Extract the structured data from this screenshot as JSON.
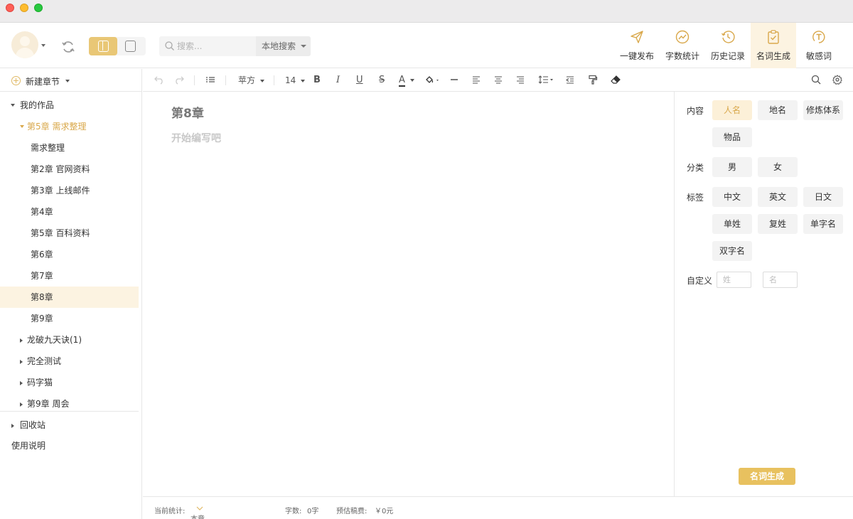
{
  "toolbar": {
    "search_placeholder": "搜索...",
    "search_scope": "本地搜索",
    "tools": [
      {
        "label": "一键发布",
        "icon": "paper-plane-icon"
      },
      {
        "label": "字数统计",
        "icon": "chart-icon"
      },
      {
        "label": "历史记录",
        "icon": "history-icon"
      },
      {
        "label": "名词生成",
        "icon": "clipboard-check-icon",
        "active": true
      },
      {
        "label": "敏感词",
        "icon": "text-circle-icon"
      }
    ]
  },
  "sidebar": {
    "new_chapter": "新建章节",
    "root": "我的作品",
    "expanded_volume": "第5章 需求整理",
    "chapters": [
      "需求整理",
      "第2章 官网资料",
      "第3章 上线邮件",
      "第4章",
      "第5章 百科资料",
      "第6章",
      "第7章",
      "第8章",
      "第9章"
    ],
    "selected_chapter": "第8章",
    "volumes": [
      "龙破九天诀(1)",
      "完全测试",
      "码字猫",
      "第9章 周会"
    ],
    "recycle_bin": "回收站",
    "manual": "使用说明"
  },
  "editor_toolbar": {
    "font": "苹方",
    "font_size": "14",
    "bold": "B",
    "italic": "I",
    "underline": "U",
    "strike": "S",
    "font_color": "A"
  },
  "editor": {
    "chapter_title": "第8章",
    "body_placeholder": "开始编写吧"
  },
  "panel": {
    "content_label": "内容",
    "content_options": [
      "人名",
      "地名",
      "修炼体系",
      "物品"
    ],
    "content_selected": "人名",
    "category_label": "分类",
    "category_options": [
      "男",
      "女"
    ],
    "tag_label": "标签",
    "tag_options": [
      "中文",
      "英文",
      "日文",
      "单姓",
      "复姓",
      "单字名",
      "双字名"
    ],
    "custom_label": "自定义",
    "surname_placeholder": "姓",
    "given_placeholder": "名",
    "generate_button": "名词生成"
  },
  "statusbar": {
    "stat_label": "当前统计:",
    "stat_scope": "本章",
    "word_label": "字数:",
    "word_count": "0字",
    "fee_label": "预估稿费:",
    "fee_value": "￥0元"
  },
  "colors": {
    "accent": "#e8c15f",
    "accent_text": "#d9a84b",
    "selected_bg": "#fcf3e1"
  }
}
